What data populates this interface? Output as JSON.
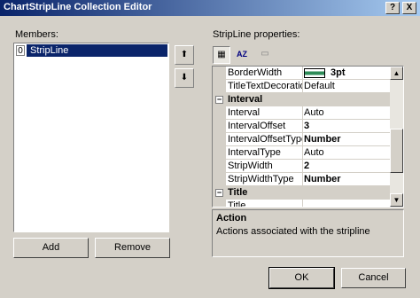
{
  "window": {
    "title": "ChartStripLine Collection Editor",
    "help_btn": "?",
    "close_btn": "X"
  },
  "members": {
    "label": "Members:",
    "items": [
      {
        "index": "0",
        "name": "StripLine"
      }
    ],
    "up_arrow": "⬆",
    "down_arrow": "⬇"
  },
  "props_label": "StripLine properties:",
  "toolbar": {
    "categorized": "▦",
    "alphabetical": "AZ",
    "pages": "▭"
  },
  "grid": {
    "rows": [
      {
        "kind": "prop",
        "name": "BorderWidth",
        "value": "3pt",
        "swatch_color": "#2e8b57",
        "bold": true
      },
      {
        "kind": "prop",
        "name": "TitleTextDecoratio",
        "value": "Default",
        "bold": false
      },
      {
        "kind": "cat",
        "name": "Interval",
        "sign": "−"
      },
      {
        "kind": "prop",
        "name": "Interval",
        "value": "Auto",
        "bold": false
      },
      {
        "kind": "prop",
        "name": "IntervalOffset",
        "value": "3",
        "bold": true
      },
      {
        "kind": "prop",
        "name": "IntervalOffsetType",
        "value": "Number",
        "bold": true
      },
      {
        "kind": "prop",
        "name": "IntervalType",
        "value": "Auto",
        "bold": false
      },
      {
        "kind": "prop",
        "name": "StripWidth",
        "value": "2",
        "bold": true
      },
      {
        "kind": "prop",
        "name": "StripWidthType",
        "value": "Number",
        "bold": true
      },
      {
        "kind": "cat",
        "name": "Title",
        "sign": "−"
      },
      {
        "kind": "prop",
        "name": "Title",
        "value": "",
        "bold": false
      }
    ]
  },
  "help": {
    "title": "Action",
    "description": "Actions associated with the stripline"
  },
  "buttons": {
    "add": "Add",
    "remove": "Remove",
    "ok": "OK",
    "cancel": "Cancel"
  },
  "colors": {
    "titlebar": "#0a246a",
    "selection": "#0a246a",
    "face": "#d4d0c8"
  }
}
